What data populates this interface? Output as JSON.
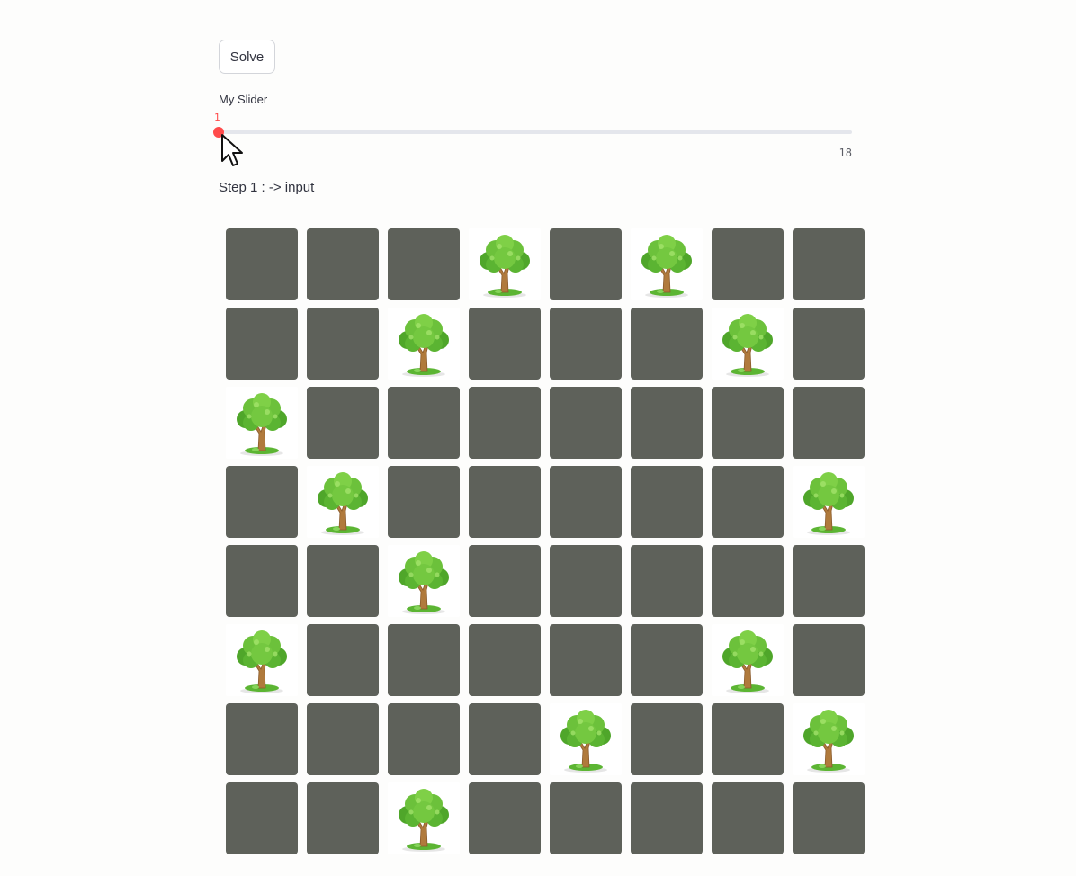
{
  "solve_button": {
    "label": "Solve"
  },
  "slider": {
    "label": "My Slider",
    "value": "1",
    "min": 1,
    "max_label": "18",
    "accent_color": "#ff4b4b"
  },
  "step_text": "Step 1 : -> input",
  "board": {
    "rows": 8,
    "cols": 8,
    "empty_color": "#5e615a",
    "tree_icon": "tree-icon",
    "grid": [
      [
        0,
        0,
        0,
        1,
        0,
        1,
        0,
        0
      ],
      [
        0,
        0,
        1,
        0,
        0,
        0,
        1,
        0
      ],
      [
        1,
        0,
        0,
        0,
        0,
        0,
        0,
        0
      ],
      [
        0,
        1,
        0,
        0,
        0,
        0,
        0,
        1
      ],
      [
        0,
        0,
        1,
        0,
        0,
        0,
        0,
        0
      ],
      [
        1,
        0,
        0,
        0,
        0,
        0,
        1,
        0
      ],
      [
        0,
        0,
        0,
        0,
        1,
        0,
        0,
        1
      ],
      [
        0,
        0,
        1,
        0,
        0,
        0,
        0,
        0
      ]
    ]
  }
}
